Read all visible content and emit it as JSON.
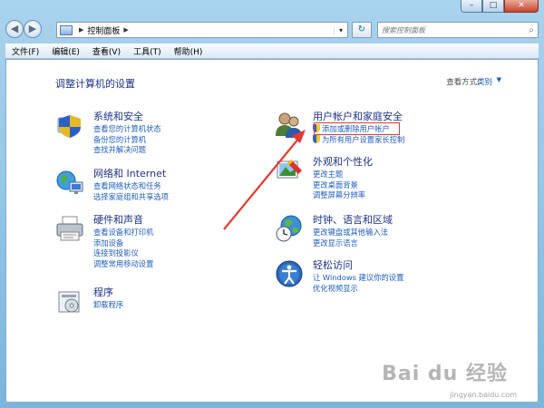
{
  "window": {
    "caption": {
      "min": "–",
      "max": "□",
      "close": "✕"
    }
  },
  "nav": {
    "back": "◀",
    "forward": "▶",
    "address": "控制面板",
    "address_sep": "▶",
    "address_drop": "▾",
    "refresh": "↻",
    "search_placeholder": "搜索控制面板",
    "search_icon": "🔍"
  },
  "menu": [
    "文件(F)",
    "编辑(E)",
    "查看(V)",
    "工具(T)",
    "帮助(H)"
  ],
  "page": {
    "title": "调整计算机的设置",
    "view_by_label": "查看方式:",
    "view_by_value": "类别",
    "view_by_arrow": "▼"
  },
  "categories_left": [
    {
      "title": "系统和安全",
      "icon": "shield-icon",
      "links": [
        "查看您的计算机状态",
        "备份您的计算机",
        "查找并解决问题"
      ]
    },
    {
      "title": "网络和 Internet",
      "icon": "network-icon",
      "links": [
        "查看网络状态和任务",
        "选择家庭组和共享选项"
      ]
    },
    {
      "title": "硬件和声音",
      "icon": "printer-icon",
      "links": [
        "查看设备和打印机",
        "添加设备",
        "连接到投影仪",
        "调整常用移动设置"
      ]
    },
    {
      "title": "程序",
      "icon": "programs-icon",
      "links": [
        "卸载程序"
      ]
    }
  ],
  "categories_right": [
    {
      "title": "用户帐户和家庭安全",
      "icon": "users-icon",
      "links": [
        "添加或删除用户帐户",
        "为所有用户设置家长控制"
      ]
    },
    {
      "title": "外观和个性化",
      "icon": "appearance-icon",
      "links": [
        "更改主题",
        "更改桌面背景",
        "调整屏幕分辨率"
      ]
    },
    {
      "title": "时钟、语言和区域",
      "icon": "globe-clock-icon",
      "links": [
        "更改键盘或其他输入法",
        "更改显示语言"
      ]
    },
    {
      "title": "轻松访问",
      "icon": "ease-of-access-icon",
      "links": [
        "让 Windows 建议你的设置",
        "优化视频显示"
      ]
    }
  ],
  "watermark": {
    "main": "Bai du 经验",
    "sub": "jingyan.baidu.com"
  },
  "colors": {
    "link": "#1f5dbf",
    "heading": "#1e3287",
    "highlight": "#e33b34"
  }
}
